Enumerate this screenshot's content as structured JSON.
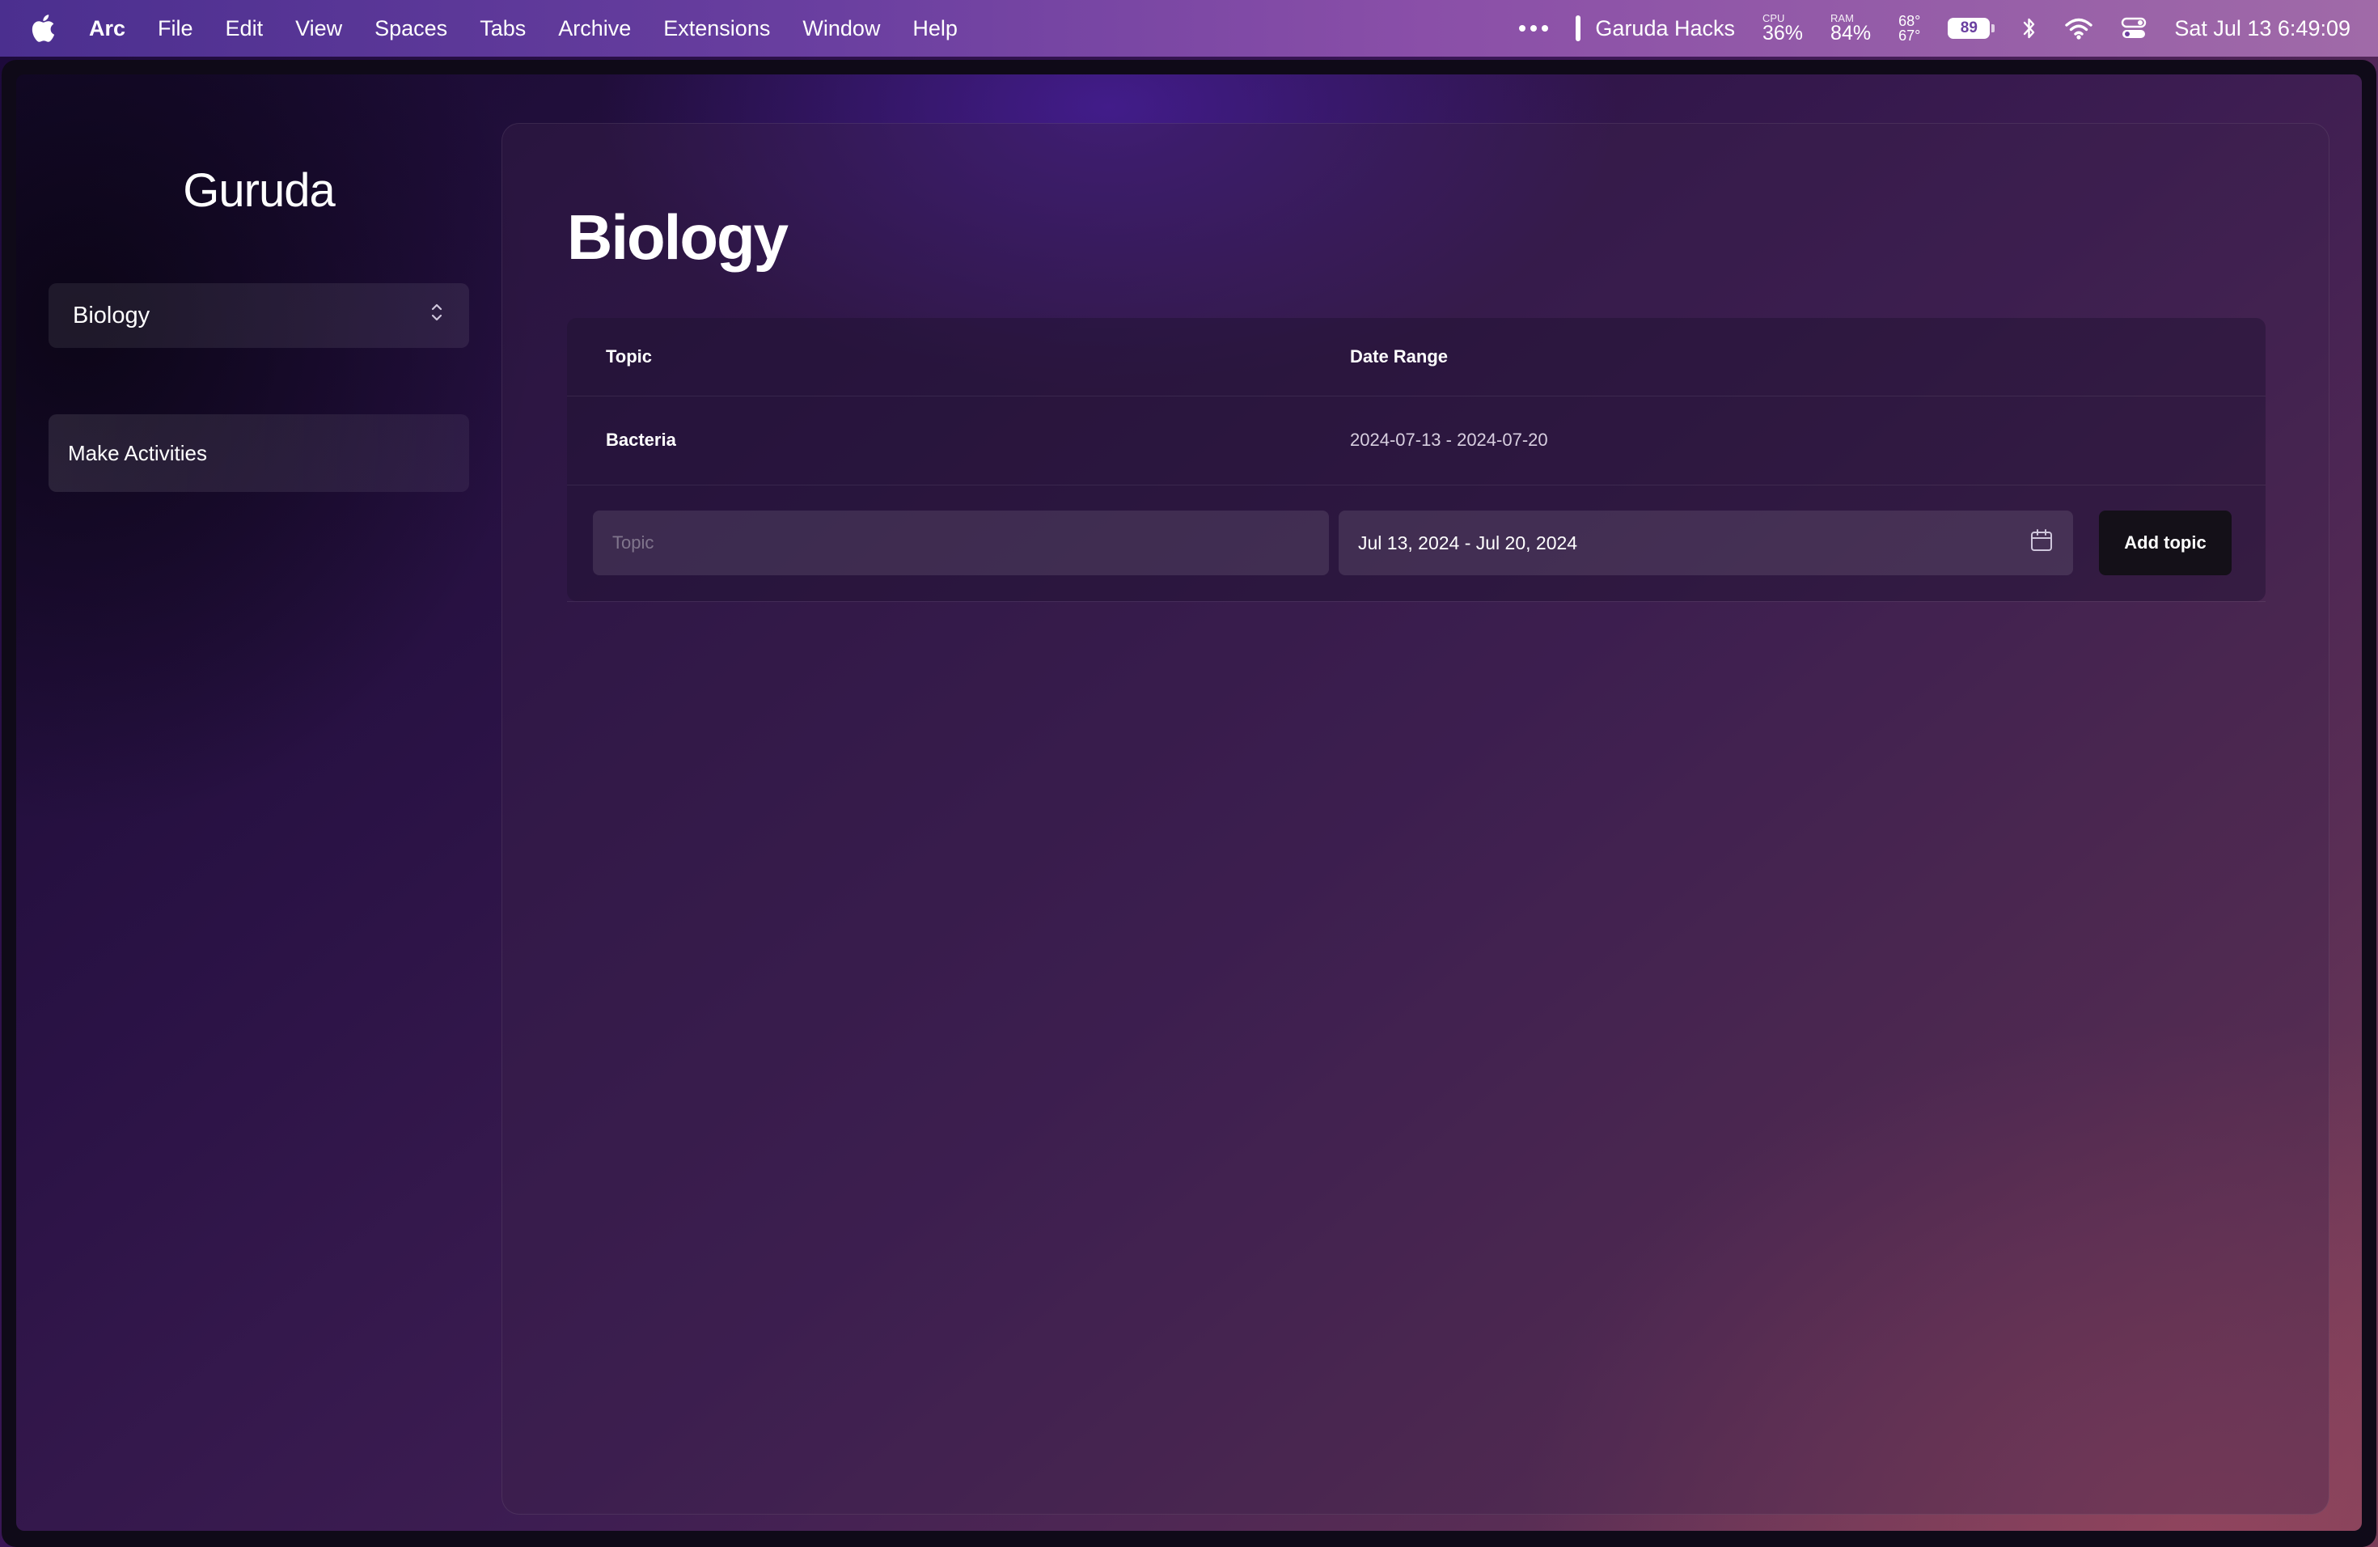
{
  "menubar": {
    "app_name": "Arc",
    "menus": [
      "File",
      "Edit",
      "View",
      "Spaces",
      "Tabs",
      "Archive",
      "Extensions",
      "Window",
      "Help"
    ],
    "space_name": "Garuda Hacks",
    "cpu_label": "CPU",
    "cpu_value": "36%",
    "ram_label": "RAM",
    "ram_value": "84%",
    "temp_high": "68°",
    "temp_low": "67°",
    "battery_level": "89",
    "datetime": "Sat Jul 13  6:49:09"
  },
  "sidebar": {
    "brand": "Guruda",
    "selected_subject": "Biology",
    "make_activities_label": "Make Activities"
  },
  "main": {
    "title": "Biology",
    "table": {
      "headers": {
        "topic": "Topic",
        "date_range": "Date Range"
      },
      "rows": [
        {
          "topic": "Bacteria",
          "date_range": "2024-07-13 - 2024-07-20"
        }
      ]
    },
    "add_form": {
      "topic_placeholder": "Topic",
      "date_range_value": "Jul 13, 2024 - Jul 20, 2024",
      "add_button_label": "Add topic"
    }
  }
}
